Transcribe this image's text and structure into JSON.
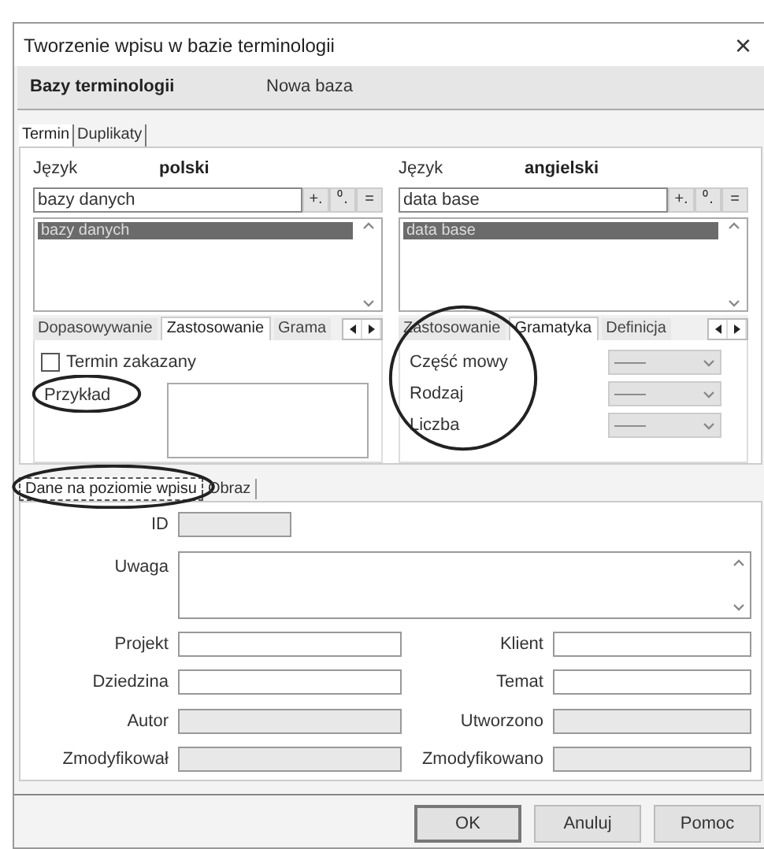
{
  "window": {
    "title": "Tworzenie wpisu w bazie terminologii",
    "close": "×"
  },
  "header": {
    "label": "Bazy terminologii",
    "value": "Nowa baza"
  },
  "tabs": [
    {
      "label": "Termin",
      "selected": true
    },
    {
      "label": "Duplikaty",
      "selected": false
    }
  ],
  "languages": [
    {
      "label": "Język",
      "language": "polski",
      "term": "bazy danych",
      "buttons": [
        "+.",
        "⁰.",
        "="
      ],
      "list": [
        {
          "text": "bazy danych",
          "selected": true
        }
      ],
      "subtabs": [
        {
          "label": "Dopasowywanie",
          "selected": false
        },
        {
          "label": "Zastosowanie",
          "selected": true
        },
        {
          "label": "Grama",
          "selected": false
        }
      ],
      "content": [
        {
          "kind": "checkbox",
          "label": "Termin zakazany",
          "checked": false
        },
        {
          "kind": "textarea",
          "label": "Przykład",
          "circled": true
        }
      ]
    },
    {
      "label": "Język",
      "language": "angielski",
      "term": "data base",
      "buttons": [
        "+.",
        "⁰.",
        "="
      ],
      "list": [
        {
          "text": "data base",
          "selected": true
        }
      ],
      "subtabs": [
        {
          "label": "Zastosowanie",
          "selected": false
        },
        {
          "label": "Gramatyka",
          "selected": true
        },
        {
          "label": "Definicja",
          "selected": false
        }
      ],
      "content": [
        {
          "kind": "grammar",
          "circled": true,
          "fields": [
            {
              "label": "Część mowy",
              "value": "——"
            },
            {
              "label": "Rodzaj",
              "value": "——"
            },
            {
              "label": "Liczba",
              "value": "——"
            }
          ]
        }
      ]
    }
  ],
  "entry_tabs": [
    {
      "label": "Dane na poziomie wpisu",
      "selected": true,
      "circled": true
    },
    {
      "label": "Obraz",
      "selected": false,
      "circled": false
    }
  ],
  "entry_fields": {
    "id": {
      "label": "ID",
      "disabled": true
    },
    "note": {
      "label": "Uwaga"
    },
    "pairs": [
      [
        {
          "label": "Projekt",
          "disabled": false
        },
        {
          "label": "Klient",
          "disabled": false
        }
      ],
      [
        {
          "label": "Dziedzina",
          "disabled": false
        },
        {
          "label": "Temat",
          "disabled": false
        }
      ],
      [
        {
          "label": "Autor",
          "disabled": true
        },
        {
          "label": "Utworzono",
          "disabled": true
        }
      ],
      [
        {
          "label": "Zmodyfikował",
          "disabled": true
        },
        {
          "label": "Zmodyfikowano",
          "disabled": true
        }
      ]
    ]
  },
  "buttons": [
    {
      "label": "OK",
      "default": true
    },
    {
      "label": "Anuluj",
      "default": false
    },
    {
      "label": "Pomoc",
      "default": false
    }
  ]
}
